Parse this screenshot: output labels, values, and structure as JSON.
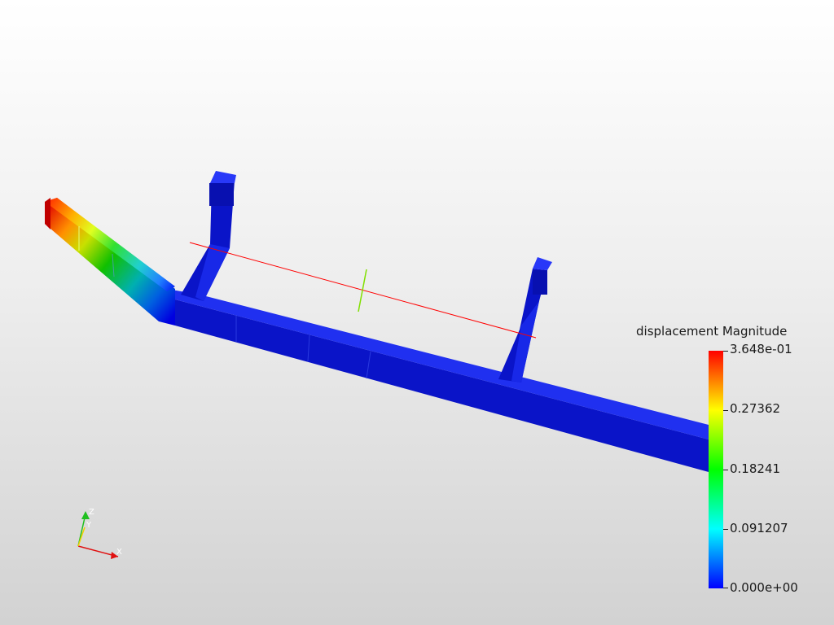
{
  "scalar_bar": {
    "title": "displacement Magnitude",
    "labels": [
      "3.648e-01",
      "0.27362",
      "0.18241",
      "0.091207",
      "0.000e+00"
    ],
    "colormap_top": "#ff0000",
    "colormap_bottom": "#0000ff"
  },
  "orientation_axes": {
    "x": "X",
    "y": "Y",
    "z": "Z"
  },
  "colors": {
    "low_displacement": "#0000ff",
    "high_displacement": "#ff0000",
    "plane_line": "#ff0000",
    "plane_normal": "#80ff00"
  }
}
